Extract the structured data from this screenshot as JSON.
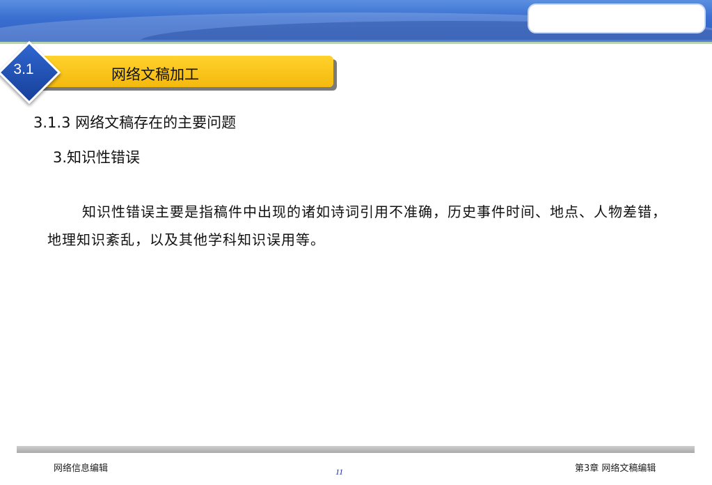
{
  "slide": {
    "section_number": "3.1",
    "section_title": "网络文稿加工",
    "subheading": "3.1.3 网络文稿存在的主要问题",
    "point": "3.知识性错误",
    "body": "知识性错误主要是指稿件中出现的诸如诗词引用不准确，历史事件时间、地点、人物差错，地理知识紊乱，以及其他学科知识误用等。"
  },
  "footer": {
    "left": "网络信息编辑",
    "page": "11",
    "right": "第3章 网络文稿编辑"
  },
  "colors": {
    "header_blue": "#3a6fd0",
    "title_bar_yellow": "#f4b90e",
    "diamond_blue": "#2f67cf",
    "page_number": "#1a2f9a"
  }
}
